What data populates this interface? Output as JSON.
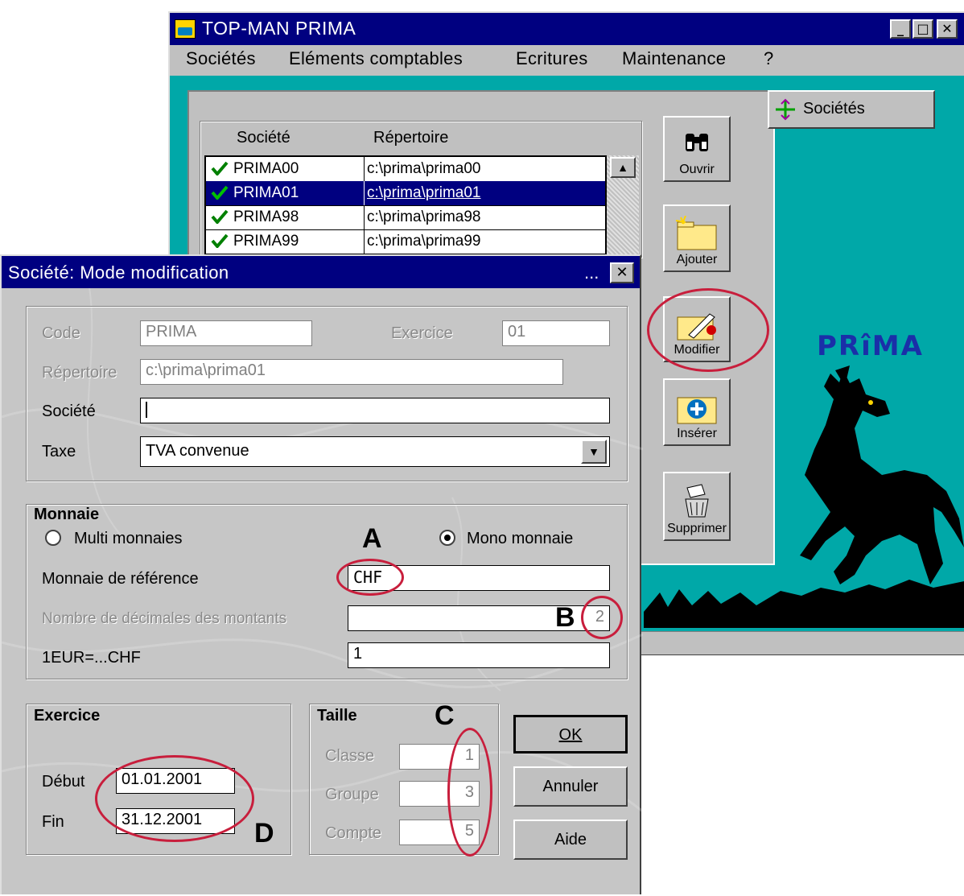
{
  "main_window": {
    "title": "TOP-MAN PRIMA",
    "menu": [
      "Sociétés",
      "Eléments comptables",
      "Ecritures",
      "Maintenance",
      "?"
    ],
    "caption_buttons": [
      "minimize-icon",
      "maximize-icon",
      "close-icon"
    ]
  },
  "societes_tab": {
    "label": "Sociétés"
  },
  "company_list": {
    "headers": [
      "Société",
      "Répertoire"
    ],
    "rows": [
      {
        "name": "PRIMA00",
        "dir": "c:\\prima\\prima00"
      },
      {
        "name": "PRIMA01",
        "dir": "c:\\prima\\prima01"
      },
      {
        "name": "PRIMA98",
        "dir": "c:\\prima\\prima98"
      },
      {
        "name": "PRIMA99",
        "dir": "c:\\prima\\prima99"
      }
    ],
    "selected_index": 1
  },
  "side_buttons": {
    "ouvrir": "Ouvrir",
    "ajouter": "Ajouter",
    "modifier": "Modifier",
    "inserer": "Insérer",
    "supprimer": "Supprimer"
  },
  "logo_text": "PRîMA",
  "dialog": {
    "title": "Société: Mode modification",
    "title_dots": "...",
    "code_label": "Code",
    "code_value": "PRIMA",
    "exercice_label": "Exercice",
    "exercice_value": "01",
    "repertoire_label": "Répertoire",
    "repertoire_value": "c:\\prima\\prima01",
    "societe_label": "Société",
    "societe_value": "",
    "taxe_label": "Taxe",
    "taxe_value": "TVA convenue",
    "monnaie": {
      "title": "Monnaie",
      "multi_label": "Multi monnaies",
      "mono_label": "Mono monnaie",
      "selected": "mono",
      "ref_label": "Monnaie de référence",
      "ref_value": "CHF",
      "decimals_label": "Nombre de décimales des montants",
      "decimals_value": "2",
      "eur_label": "1EUR=...CHF",
      "eur_value": "1"
    },
    "exercice_group": {
      "title": "Exercice",
      "debut_label": "Début",
      "debut_value": "01.01.2001",
      "fin_label": "Fin",
      "fin_value": "31.12.2001"
    },
    "taille_group": {
      "title": "Taille",
      "classe_label": "Classe",
      "classe_value": "1",
      "groupe_label": "Groupe",
      "groupe_value": "3",
      "compte_label": "Compte",
      "compte_value": "5"
    },
    "buttons": {
      "ok": "OK",
      "annuler": "Annuler",
      "aide": "Aide"
    }
  },
  "annotations": {
    "a": "A",
    "b": "B",
    "c": "C",
    "d": "D"
  },
  "colors": {
    "title_bar": "#000080",
    "desktop": "#00a8a8",
    "face": "#c0c0c0",
    "annotation": "#c81e3c"
  }
}
